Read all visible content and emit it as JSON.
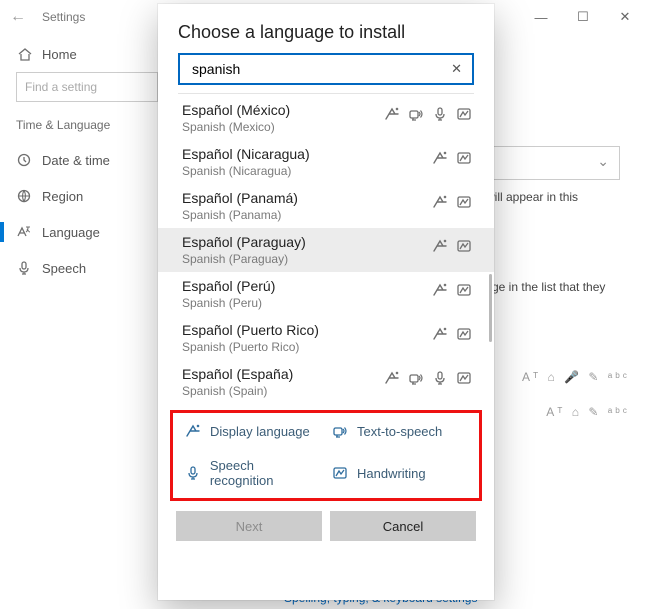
{
  "window": {
    "title": "Settings",
    "home": "Home",
    "find_placeholder": "Find a setting",
    "group": "Time & Language",
    "nav": {
      "date": "Date & time",
      "region": "Region",
      "language": "Language",
      "speech": "Speech"
    },
    "side_text1": "will appear in this",
    "side_text2": "ge in the list that they",
    "bottom_link": "Spelling, typing, & keyboard settings"
  },
  "dialog": {
    "title": "Choose a language to install",
    "search_value": "spanish",
    "clear": "✕",
    "legend": {
      "display": "Display language",
      "tts": "Text-to-speech",
      "speech": "Speech recognition",
      "hand": "Handwriting"
    },
    "buttons": {
      "next": "Next",
      "cancel": "Cancel"
    },
    "results": [
      {
        "native": "Español (México)",
        "local": "Spanish (Mexico)",
        "feat": [
          "display",
          "tts",
          "speech",
          "hand"
        ]
      },
      {
        "native": "Español (Nicaragua)",
        "local": "Spanish (Nicaragua)",
        "feat": [
          "display",
          "hand"
        ]
      },
      {
        "native": "Español (Panamá)",
        "local": "Spanish (Panama)",
        "feat": [
          "display",
          "hand"
        ]
      },
      {
        "native": "Español (Paraguay)",
        "local": "Spanish (Paraguay)",
        "feat": [
          "display",
          "hand"
        ],
        "selected": true
      },
      {
        "native": "Español (Perú)",
        "local": "Spanish (Peru)",
        "feat": [
          "display",
          "hand"
        ]
      },
      {
        "native": "Español (Puerto Rico)",
        "local": "Spanish (Puerto Rico)",
        "feat": [
          "display",
          "hand"
        ]
      },
      {
        "native": "Español (España)",
        "local": "Spanish (Spain)",
        "feat": [
          "display",
          "tts",
          "speech",
          "hand"
        ]
      }
    ]
  }
}
